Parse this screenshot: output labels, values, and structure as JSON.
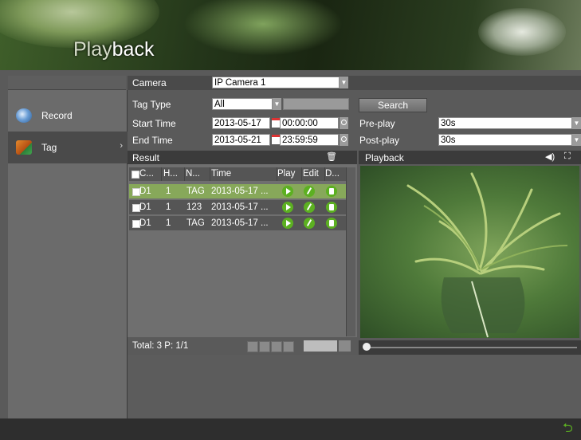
{
  "title": {
    "highlight": "Play",
    "rest": "back"
  },
  "sidebar": {
    "items": [
      {
        "label": "Record",
        "icon": "record-icon"
      },
      {
        "label": "Tag",
        "icon": "tag-icon",
        "chevron": "›"
      }
    ]
  },
  "search": {
    "camera_label": "Camera",
    "camera_value": "IP Camera 1",
    "tag_type_label": "Tag Type",
    "tag_type_value": "All",
    "start_time_label": "Start Time",
    "start_date": "2013-05-17",
    "start_time": "00:00:00",
    "end_time_label": "End Time",
    "end_date": "2013-05-21",
    "end_time": "23:59:59",
    "search_button": "Search",
    "preplay_label": "Pre-play",
    "preplay_value": "30s",
    "postplay_label": "Post-play",
    "postplay_value": "30s"
  },
  "result": {
    "title": "Result",
    "columns": [
      "C...",
      "H...",
      "N...",
      "Time",
      "Play",
      "Edit",
      "D..."
    ],
    "rows": [
      {
        "camera": "D1",
        "h": "1",
        "name": "TAG",
        "time": "2013-05-17 ..."
      },
      {
        "camera": "D1",
        "h": "1",
        "name": "123",
        "time": "2013-05-17 ..."
      },
      {
        "camera": "D1",
        "h": "1",
        "name": "TAG",
        "time": "2013-05-17 ..."
      }
    ],
    "total": "Total: 3  P: 1/1"
  },
  "playback": {
    "title": "Playback"
  },
  "colors": {
    "accent": "#5cb021",
    "selected_row": "#87a85a"
  }
}
